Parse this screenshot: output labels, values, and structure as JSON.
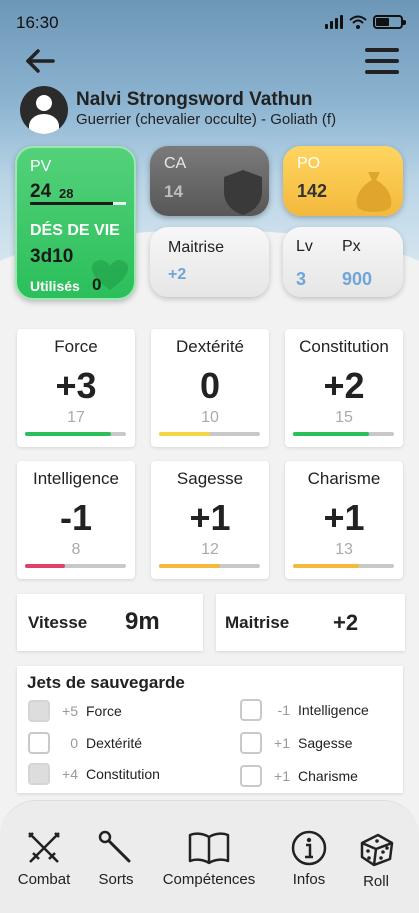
{
  "status": {
    "time": "16:30"
  },
  "character": {
    "name": "Nalvi Strongsword Vathun",
    "subtitle": "Guerrier (chevalier occulte) - Goliath (f)"
  },
  "pv": {
    "label": "PV",
    "current": "24",
    "max": "28",
    "fraction": 0.86,
    "hit_dice_label": "DÉS DE VIE",
    "hit_dice": "3d10",
    "used_label": "Utilisés",
    "used": "0"
  },
  "ca": {
    "label": "CA",
    "value": "14"
  },
  "po": {
    "label": "PO",
    "value": "142"
  },
  "maitrise_card": {
    "label": "Maitrise",
    "value": "+2"
  },
  "level": {
    "lv_label": "Lv",
    "px_label": "Px",
    "lv": "3",
    "px": "900"
  },
  "abilities": [
    {
      "name": "Force",
      "mod": "+3",
      "score": "17",
      "fill": 0.85,
      "color": "#2bbf5b"
    },
    {
      "name": "Dextérité",
      "mod": "0",
      "score": "10",
      "fill": 0.5,
      "color": "#f5d547"
    },
    {
      "name": "Constitution",
      "mod": "+2",
      "score": "15",
      "fill": 0.75,
      "color": "#2bbf5b"
    },
    {
      "name": "Intelligence",
      "mod": "-1",
      "score": "8",
      "fill": 0.4,
      "color": "#e0406a"
    },
    {
      "name": "Sagesse",
      "mod": "+1",
      "score": "12",
      "fill": 0.6,
      "color": "#f3b93c"
    },
    {
      "name": "Charisme",
      "mod": "+1",
      "score": "13",
      "fill": 0.65,
      "color": "#f3b93c"
    }
  ],
  "speed": {
    "label": "Vitesse",
    "value": "9m"
  },
  "proficiency": {
    "label": "Maitrise",
    "value": "+2"
  },
  "saves": {
    "title": "Jets de sauvegarde",
    "items": [
      {
        "value": "+5",
        "name": "Force",
        "proficient": true
      },
      {
        "value": "0",
        "name": "Dextérité",
        "proficient": false
      },
      {
        "value": "+4",
        "name": "Constitution",
        "proficient": true
      },
      {
        "value": "-1",
        "name": "Intelligence",
        "proficient": false
      },
      {
        "value": "+1",
        "name": "Sagesse",
        "proficient": false
      },
      {
        "value": "+1",
        "name": "Charisme",
        "proficient": false
      }
    ]
  },
  "nav": [
    {
      "label": "Combat",
      "icon": "crossed-swords-icon"
    },
    {
      "label": "Sorts",
      "icon": "wand-icon"
    },
    {
      "label": "Compétences",
      "icon": "book-icon"
    },
    {
      "label": "Infos",
      "icon": "info-icon"
    },
    {
      "label": "Roll",
      "icon": "dice-icon"
    }
  ]
}
